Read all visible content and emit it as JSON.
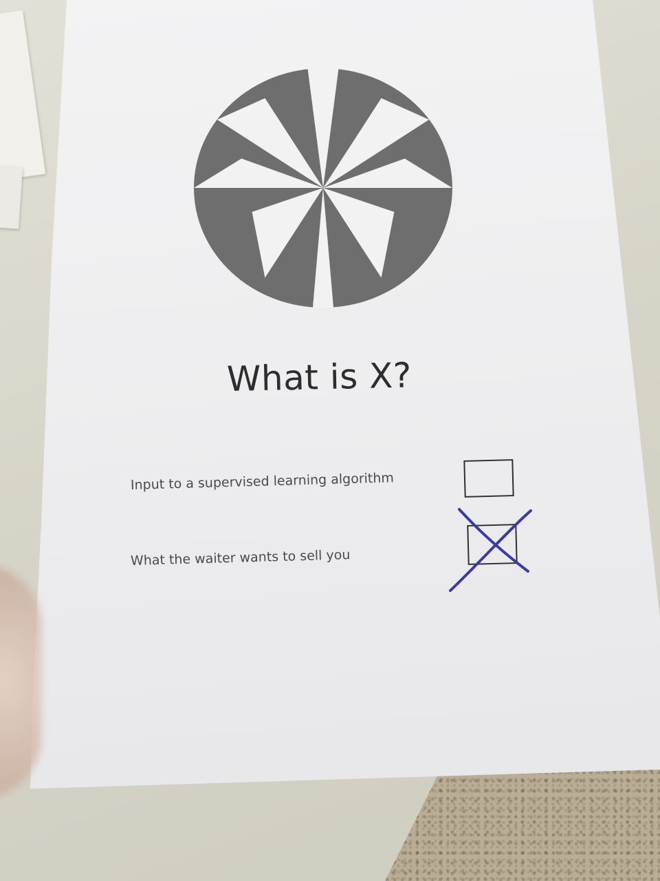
{
  "document": {
    "question": "What is X?",
    "options": [
      {
        "label": "Input to a supervised learning algorithm",
        "checked": false
      },
      {
        "label": "What the waiter wants to sell you",
        "checked": true
      }
    ]
  },
  "colors": {
    "paper": "#f0f0f1",
    "logo_fill": "#6b6b6b",
    "text": "#2d2d2f",
    "pen_ink": "#3b3fa0"
  },
  "icons": {
    "logo": "pinwheel-circle-logo",
    "mark": "hand-drawn-x-mark"
  }
}
